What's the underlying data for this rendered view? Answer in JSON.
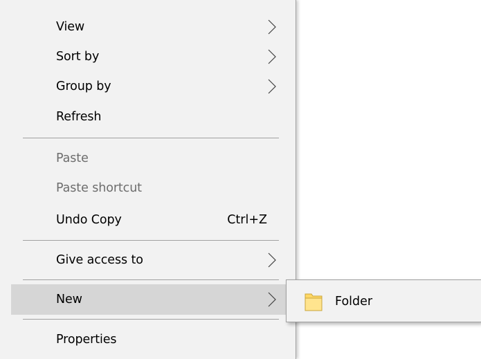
{
  "context_menu": {
    "items": [
      {
        "label": "View",
        "shortcut": "",
        "disabled": false,
        "has_submenu": true
      },
      {
        "label": "Sort by",
        "shortcut": "",
        "disabled": false,
        "has_submenu": true
      },
      {
        "label": "Group by",
        "shortcut": "",
        "disabled": false,
        "has_submenu": true
      },
      {
        "label": "Refresh",
        "shortcut": "",
        "disabled": false,
        "has_submenu": false
      },
      {
        "label": "Paste",
        "shortcut": "",
        "disabled": true,
        "has_submenu": false
      },
      {
        "label": "Paste shortcut",
        "shortcut": "",
        "disabled": true,
        "has_submenu": false
      },
      {
        "label": "Undo Copy",
        "shortcut": "Ctrl+Z",
        "disabled": false,
        "has_submenu": false
      },
      {
        "label": "Give access to",
        "shortcut": "",
        "disabled": false,
        "has_submenu": true
      },
      {
        "label": "New",
        "shortcut": "",
        "disabled": false,
        "has_submenu": true,
        "highlighted": true
      },
      {
        "label": "Properties",
        "shortcut": "",
        "disabled": false,
        "has_submenu": false
      }
    ]
  },
  "submenu_new": {
    "items": [
      {
        "label": "Folder",
        "icon": "folder-icon"
      }
    ]
  },
  "colors": {
    "menu_background": "#f2f2f2",
    "highlight": "#d6d6d6",
    "separator": "#a0a0a0",
    "disabled_text": "#6d6d6d",
    "folder_yellow": "#ffd865"
  }
}
